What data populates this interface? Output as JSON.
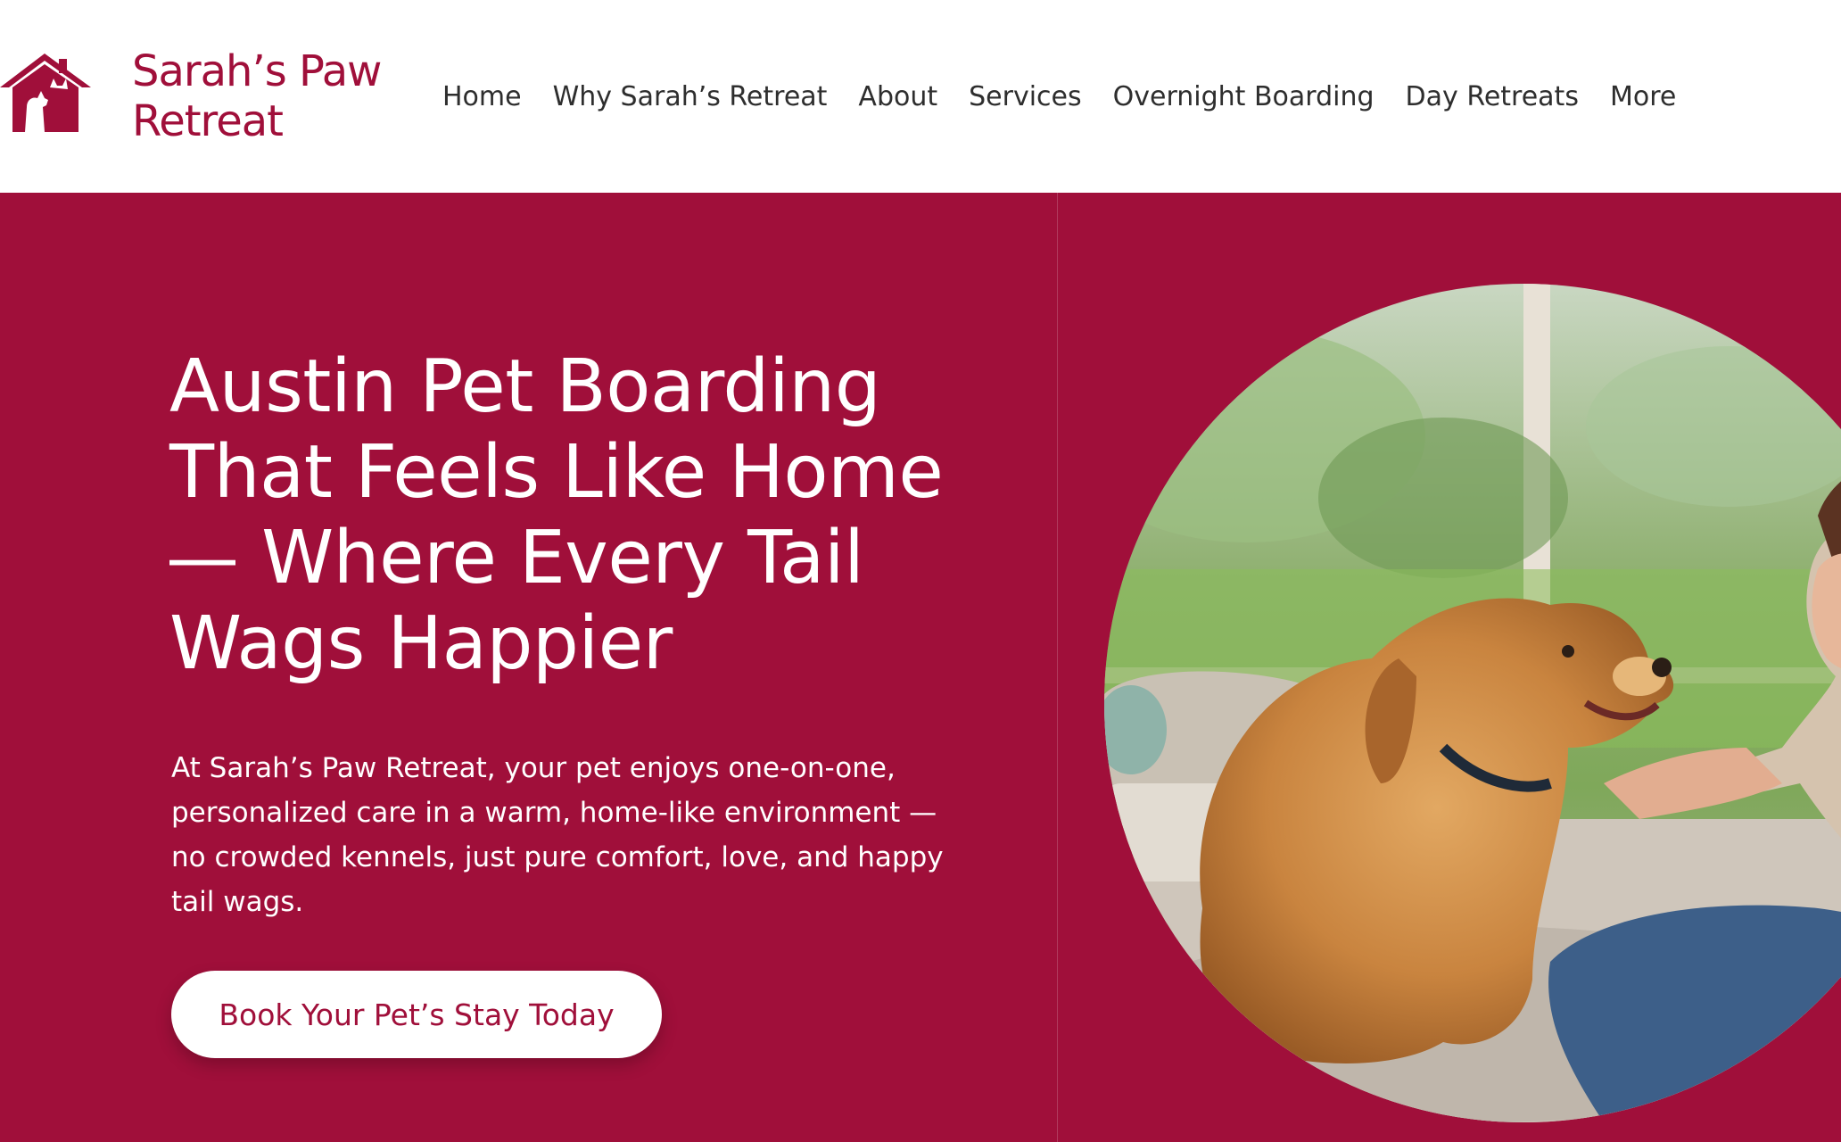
{
  "brand": {
    "name_line1": "Sarah’s Paw",
    "name_line2": "Retreat",
    "logo_icon": "house-pet-logo-icon",
    "color": "#a00f3a"
  },
  "nav": {
    "items": [
      {
        "label": "Home"
      },
      {
        "label": "Why Sarah’s Retreat"
      },
      {
        "label": "About"
      },
      {
        "label": "Services"
      },
      {
        "label": "Overnight Boarding"
      },
      {
        "label": "Day Retreats"
      },
      {
        "label": "More"
      }
    ]
  },
  "hero": {
    "background": "#a00f3a",
    "headline_lines": [
      "Austin Pet Boarding",
      "That Feels Like Home",
      "— Where Every Tail",
      "Wags Happier"
    ],
    "subtext_lines": [
      "At Sarah’s Paw Retreat, your pet enjoys one-on-one,",
      "personalized care in a warm, home-like environment —",
      "no crowded kennels, just pure comfort, love, and happy",
      "tail wags."
    ],
    "cta_label": "Book Your Pet’s Stay Today"
  }
}
